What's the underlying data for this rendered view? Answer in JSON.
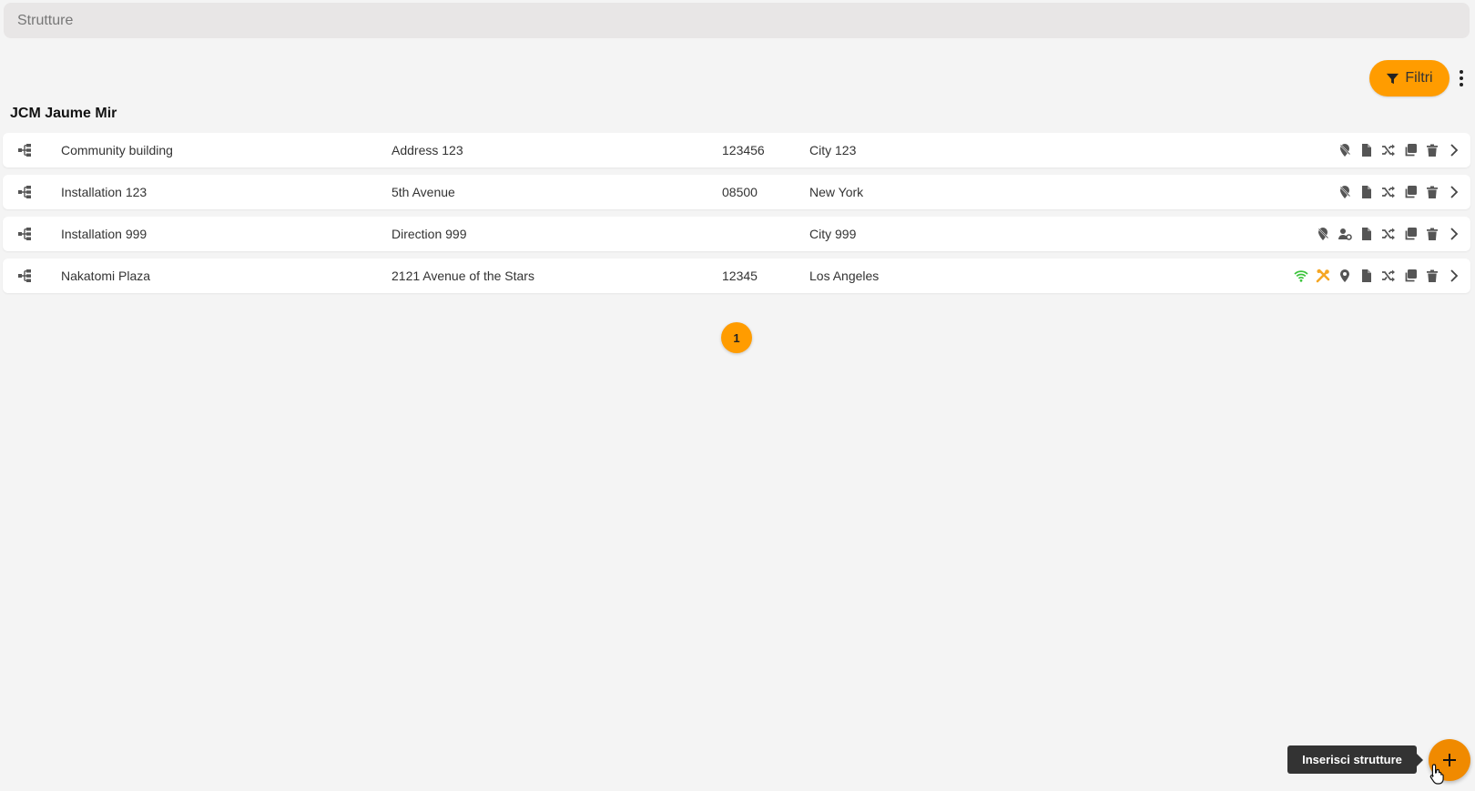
{
  "search": {
    "placeholder": "Strutture"
  },
  "toolbar": {
    "filter_label": "Filtri"
  },
  "group": {
    "title": "JCM Jaume Mir"
  },
  "rows": [
    {
      "name": "Community building",
      "address": "Address 123",
      "zip": "123456",
      "city": "City 123"
    },
    {
      "name": "Installation 123",
      "address": "5th Avenue",
      "zip": "08500",
      "city": "New York"
    },
    {
      "name": "Installation 999",
      "address": "Direction 999",
      "zip": "",
      "city": "City 999"
    },
    {
      "name": "Nakatomi Plaza",
      "address": "2121 Avenue of the Stars",
      "zip": "12345",
      "city": "Los Angeles"
    }
  ],
  "row_actions": [
    [
      "location-slash-icon",
      "file-icon",
      "shuffle-icon",
      "copy-icon",
      "trash-icon",
      "chevron-right-icon"
    ],
    [
      "location-slash-icon",
      "file-icon",
      "shuffle-icon",
      "copy-icon",
      "trash-icon",
      "chevron-right-icon"
    ],
    [
      "location-slash-icon",
      "user-gear-icon",
      "file-icon",
      "shuffle-icon",
      "copy-icon",
      "trash-icon",
      "chevron-right-icon"
    ],
    [
      "wifi-icon",
      "tools-icon",
      "location-pin-icon",
      "file-icon",
      "shuffle-icon",
      "copy-icon",
      "trash-icon",
      "chevron-right-icon"
    ]
  ],
  "pagination": {
    "current": "1"
  },
  "fab": {
    "tooltip": "Inserisci strutture",
    "icon": "plus-icon"
  },
  "colors": {
    "accent": "#ff9c00",
    "fab": "#f08a00",
    "wifi": "#3cc43c",
    "tools": "#f5a623",
    "icon": "#555555"
  }
}
